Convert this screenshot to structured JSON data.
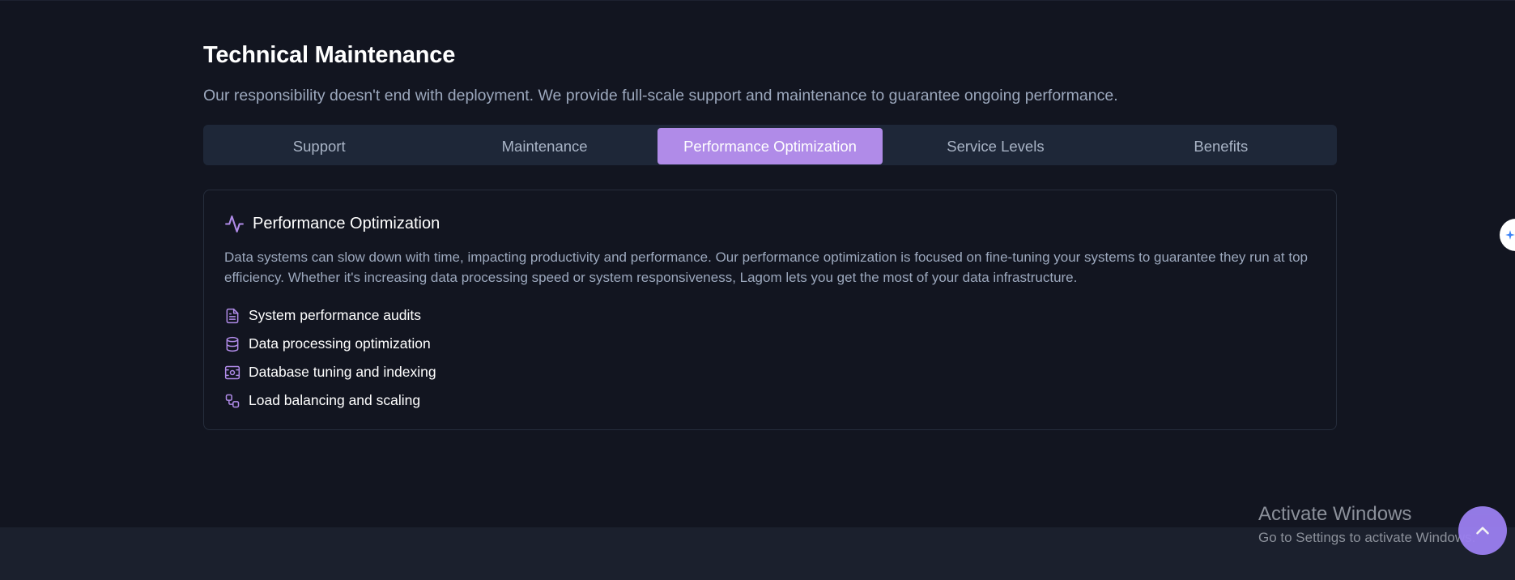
{
  "header": {
    "title": "Technical Maintenance",
    "subtitle": "Our responsibility doesn't end with deployment. We provide full-scale support and maintenance to guarantee ongoing performance."
  },
  "tabs": [
    {
      "label": "Support",
      "active": false
    },
    {
      "label": "Maintenance",
      "active": false
    },
    {
      "label": "Performance Optimization",
      "active": true
    },
    {
      "label": "Service Levels",
      "active": false
    },
    {
      "label": "Benefits",
      "active": false
    }
  ],
  "panel": {
    "icon": "activity-icon",
    "title": "Performance Optimization",
    "description": "Data systems can slow down with time, impacting productivity and performance. Our performance optimization is focused on fine-tuning your systems to guarantee they run at top efficiency. Whether it's increasing data processing speed or system responsiveness, Lagom lets you get the most of your data infrastructure.",
    "features": [
      {
        "icon": "file-text-icon",
        "label": "System performance audits"
      },
      {
        "icon": "database-icon",
        "label": "Data processing optimization"
      },
      {
        "icon": "server-cog-icon",
        "label": "Database tuning and indexing"
      },
      {
        "icon": "workflow-icon",
        "label": "Load balancing and scaling"
      }
    ]
  },
  "overlay": {
    "watermark_title": "Activate Windows",
    "watermark_subtitle": "Go to Settings to activate Windows.",
    "scroll_top_icon": "chevron-up-icon",
    "side_widget_icon": "sparkle-icon"
  },
  "colors": {
    "background": "#121520",
    "accent": "#b08be8",
    "tab_bar": "#1e2738",
    "muted_text": "#9ca8bd",
    "scroll_button": "#9b7ff0"
  }
}
